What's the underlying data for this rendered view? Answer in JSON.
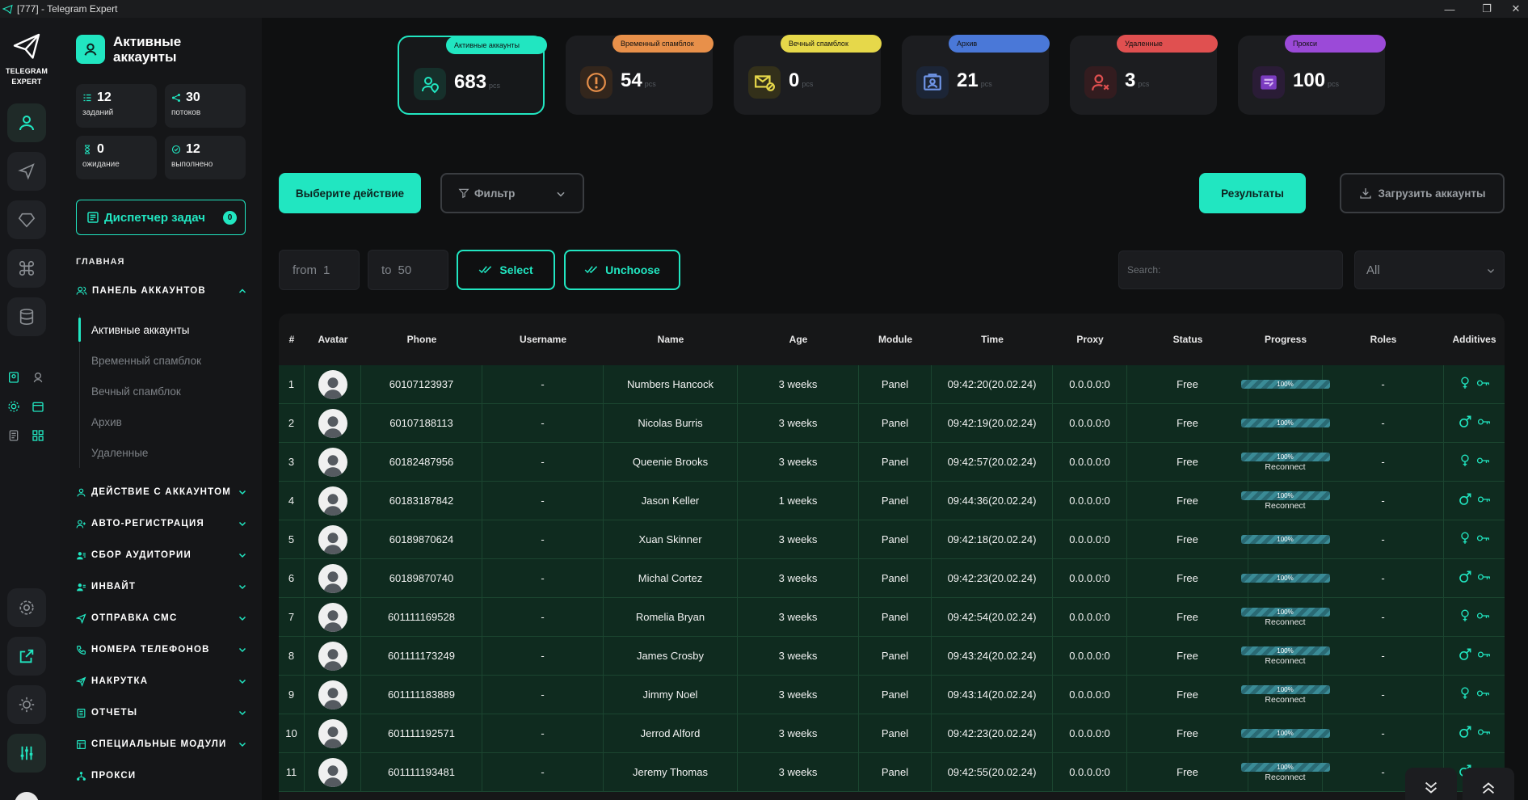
{
  "window": {
    "title": "[777] - Telegram Expert"
  },
  "brand": {
    "line1": "TELEGRAM",
    "line2": "EXPERT"
  },
  "panel": {
    "title": "Активные аккаунты"
  },
  "stats": [
    {
      "value": "12",
      "label": "заданий"
    },
    {
      "value": "30",
      "label": "потоков"
    },
    {
      "value": "0",
      "label": "ожидание"
    },
    {
      "value": "12",
      "label": "выполнено"
    }
  ],
  "dispatch": {
    "label": "Диспетчер задач",
    "count": "0"
  },
  "nav": {
    "section": "ГЛАВНАЯ",
    "account_panel": "ПАНЕЛЬ АККАУНТОВ",
    "sub": [
      "Активные аккаунты",
      "Временный спамблок",
      "Вечный спамблок",
      "Архив",
      "Удаленные"
    ],
    "groups": [
      "ДЕЙСТВИЕ С АККАУНТОМ",
      "АВТО-РЕГИСТРАЦИЯ",
      "СБОР АУДИТОРИИ",
      "ИНВАЙТ",
      "ОТПРАВКА СМС",
      "НОМЕРА ТЕЛЕФОНОВ",
      "НАКРУТКА",
      "ОТЧЕТЫ",
      "СПЕЦИАЛЬНЫЕ МОДУЛИ",
      "ПРОКСИ"
    ]
  },
  "cards": [
    {
      "tag": "Активные аккаунты",
      "value": "683",
      "unit": "pcs",
      "color": "#21e6c1"
    },
    {
      "tag": "Временный спамблок",
      "value": "54",
      "unit": "pcs",
      "color": "#e8904a"
    },
    {
      "tag": "Вечный спамблок",
      "value": "0",
      "unit": "pcs",
      "color": "#e6d84a"
    },
    {
      "tag": "Архив",
      "value": "21",
      "unit": "pcs",
      "color": "#4a78d8"
    },
    {
      "tag": "Удаленные",
      "value": "3",
      "unit": "pcs",
      "color": "#e05050"
    },
    {
      "tag": "Прокси",
      "value": "100",
      "unit": "pcs",
      "color": "#9b4ad8"
    }
  ],
  "toolbar": {
    "action": "Выберите действие",
    "filter": "Фильтр",
    "results": "Результаты",
    "upload": "Загрузить аккаунты",
    "from_label": "from",
    "from_value": "1",
    "to_label": "to",
    "to_value": "50",
    "select": "Select",
    "unchoose": "Unchoose",
    "search_placeholder": "Search:",
    "scope": "All"
  },
  "table": {
    "headers": [
      "#",
      "Avatar",
      "Phone",
      "Username",
      "Name",
      "Age",
      "Module",
      "Time",
      "Proxy",
      "Status",
      "Progress",
      "Roles",
      "Additives"
    ],
    "rows": [
      {
        "n": "1",
        "phone": "60107123937",
        "username": "-",
        "name": "Numbers Hancock",
        "age": "3 weeks",
        "module": "Panel",
        "time": "09:42:20(20.02.24)",
        "proxy": "0.0.0.0:0",
        "status": "Free",
        "progress": 100,
        "progress_label": "100%",
        "note": "",
        "roles": "-",
        "sex": "female",
        "key": "O→"
      },
      {
        "n": "2",
        "phone": "60107188113",
        "username": "-",
        "name": "Nicolas Burris",
        "age": "3 weeks",
        "module": "Panel",
        "time": "09:42:19(20.02.24)",
        "proxy": "0.0.0.0:0",
        "status": "Free",
        "progress": 100,
        "progress_label": "100%",
        "note": "",
        "roles": "-",
        "sex": "male",
        "key": "O→"
      },
      {
        "n": "3",
        "phone": "60182487956",
        "username": "-",
        "name": "Queenie Brooks",
        "age": "3 weeks",
        "module": "Panel",
        "time": "09:42:57(20.02.24)",
        "proxy": "0.0.0.0:0",
        "status": "Free",
        "progress": 100,
        "progress_label": "100%",
        "note": "Reconnect",
        "roles": "-",
        "sex": "female",
        "key": "O→"
      },
      {
        "n": "4",
        "phone": "60183187842",
        "username": "-",
        "name": "Jason Keller",
        "age": "1 weeks",
        "module": "Panel",
        "time": "09:44:36(20.02.24)",
        "proxy": "0.0.0.0:0",
        "status": "Free",
        "progress": 100,
        "progress_label": "100%",
        "note": "Reconnect",
        "roles": "-",
        "sex": "male",
        "key": "O→"
      },
      {
        "n": "5",
        "phone": "60189870624",
        "username": "-",
        "name": "Xuan Skinner",
        "age": "3 weeks",
        "module": "Panel",
        "time": "09:42:18(20.02.24)",
        "proxy": "0.0.0.0:0",
        "status": "Free",
        "progress": 100,
        "progress_label": "100%",
        "note": "",
        "roles": "-",
        "sex": "female",
        "key": "O→"
      },
      {
        "n": "6",
        "phone": "60189870740",
        "username": "-",
        "name": "Michal Cortez",
        "age": "3 weeks",
        "module": "Panel",
        "time": "09:42:23(20.02.24)",
        "proxy": "0.0.0.0:0",
        "status": "Free",
        "progress": 100,
        "progress_label": "100%",
        "note": "",
        "roles": "-",
        "sex": "male",
        "key": "O→"
      },
      {
        "n": "7",
        "phone": "601111169528",
        "username": "-",
        "name": "Romelia Bryan",
        "age": "3 weeks",
        "module": "Panel",
        "time": "09:42:54(20.02.24)",
        "proxy": "0.0.0.0:0",
        "status": "Free",
        "progress": 100,
        "progress_label": "100%",
        "note": "Reconnect",
        "roles": "-",
        "sex": "female",
        "key": "O→"
      },
      {
        "n": "8",
        "phone": "601111173249",
        "username": "-",
        "name": "James Crosby",
        "age": "3 weeks",
        "module": "Panel",
        "time": "09:43:24(20.02.24)",
        "proxy": "0.0.0.0:0",
        "status": "Free",
        "progress": 100,
        "progress_label": "100%",
        "note": "Reconnect",
        "roles": "-",
        "sex": "male",
        "key": "O→"
      },
      {
        "n": "9",
        "phone": "601111183889",
        "username": "-",
        "name": "Jimmy Noel",
        "age": "3 weeks",
        "module": "Panel",
        "time": "09:43:14(20.02.24)",
        "proxy": "0.0.0.0:0",
        "status": "Free",
        "progress": 100,
        "progress_label": "100%",
        "note": "Reconnect",
        "roles": "-",
        "sex": "female",
        "key": "O→"
      },
      {
        "n": "10",
        "phone": "601111192571",
        "username": "-",
        "name": "Jerrod Alford",
        "age": "3 weeks",
        "module": "Panel",
        "time": "09:42:23(20.02.24)",
        "proxy": "0.0.0.0:0",
        "status": "Free",
        "progress": 100,
        "progress_label": "100%",
        "note": "",
        "roles": "-",
        "sex": "male",
        "key": "O→"
      },
      {
        "n": "11",
        "phone": "601111193481",
        "username": "-",
        "name": "Jeremy Thomas",
        "age": "3 weeks",
        "module": "Panel",
        "time": "09:42:55(20.02.24)",
        "proxy": "0.0.0.0:0",
        "status": "Free",
        "progress": 100,
        "progress_label": "100%",
        "note": "Reconnect",
        "roles": "-",
        "sex": "male",
        "key": "O→"
      }
    ]
  },
  "colors": {
    "accent": "#21e6c1",
    "row_bg": "#0f2b1f",
    "bg": "#0f1011"
  }
}
